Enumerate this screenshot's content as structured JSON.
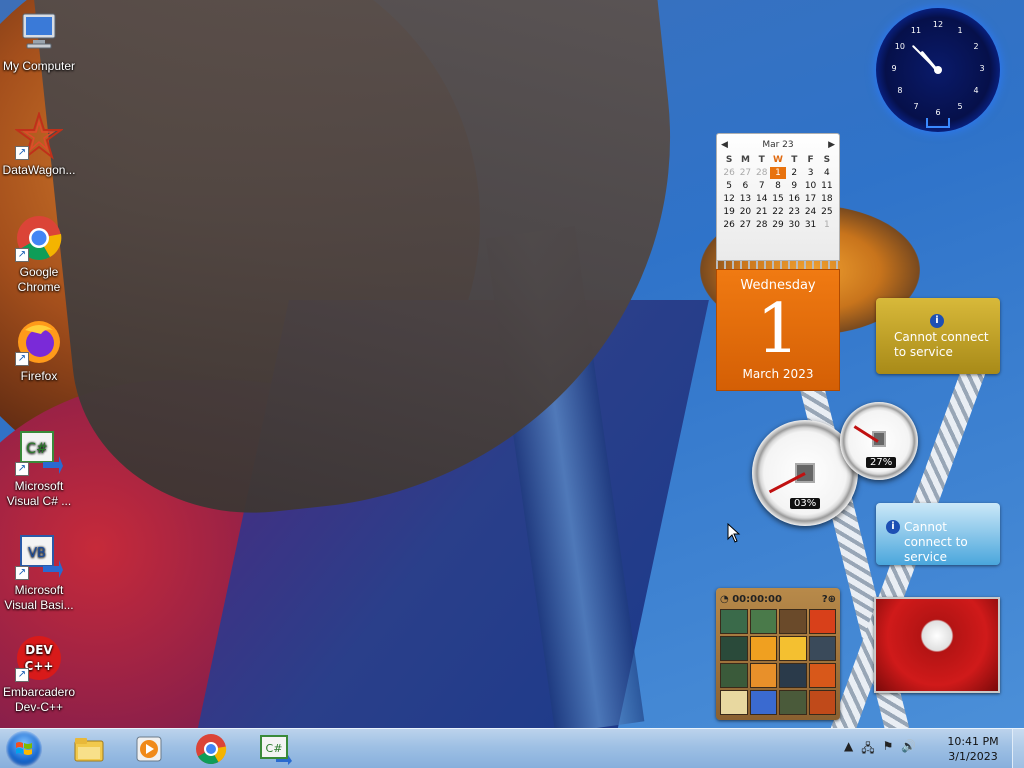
{
  "desktop": {
    "icons": [
      {
        "label": "My Computer",
        "icon": "computer-icon"
      },
      {
        "label": "DataWagon...",
        "icon": "datawagon-icon"
      },
      {
        "label": "Google Chrome",
        "icon": "chrome-icon"
      },
      {
        "label": "Firefox",
        "icon": "firefox-icon"
      },
      {
        "label": "Microsoft Visual C# ...",
        "icon": "visual-csharp-icon"
      },
      {
        "label": "Microsoft Visual Basi...",
        "icon": "visual-basic-icon"
      },
      {
        "label": "Embarcadero Dev-C++",
        "icon": "devcpp-icon"
      }
    ]
  },
  "gadgets": {
    "clock": {
      "numbers": [
        "12",
        "1",
        "2",
        "3",
        "4",
        "5",
        "6",
        "7",
        "8",
        "9",
        "10",
        "11"
      ]
    },
    "calendar": {
      "month_label": "Mar 23",
      "weekday_headers": [
        "S",
        "M",
        "T",
        "W",
        "T",
        "F",
        "S"
      ],
      "weeks": [
        [
          "26",
          "27",
          "28",
          "1",
          "2",
          "3",
          "4"
        ],
        [
          "5",
          "6",
          "7",
          "8",
          "9",
          "10",
          "11"
        ],
        [
          "12",
          "13",
          "14",
          "15",
          "16",
          "17",
          "18"
        ],
        [
          "19",
          "20",
          "21",
          "22",
          "23",
          "24",
          "25"
        ],
        [
          "26",
          "27",
          "28",
          "29",
          "30",
          "31",
          "1"
        ]
      ],
      "weekday": "Wednesday",
      "day": "1",
      "month_year": "March 2023"
    },
    "feed_gold": {
      "message": "Cannot connect to service"
    },
    "feed_blue": {
      "message": "Cannot connect to service"
    },
    "cpu_meter": {
      "cpu": "03%",
      "memory": "27%",
      "cpu_fraction": 0.03,
      "memory_fraction": 0.27
    },
    "puzzle": {
      "timer": "00:00:00"
    }
  },
  "taskbar": {
    "apps": [
      "windows-explorer-icon",
      "media-player-icon",
      "chrome-icon",
      "visual-csharp-icon"
    ],
    "time": "10:41 PM",
    "date": "3/1/2023"
  },
  "colors": {
    "calendar_accent": "#e8720e",
    "taskbar": "#9ec0e4"
  }
}
